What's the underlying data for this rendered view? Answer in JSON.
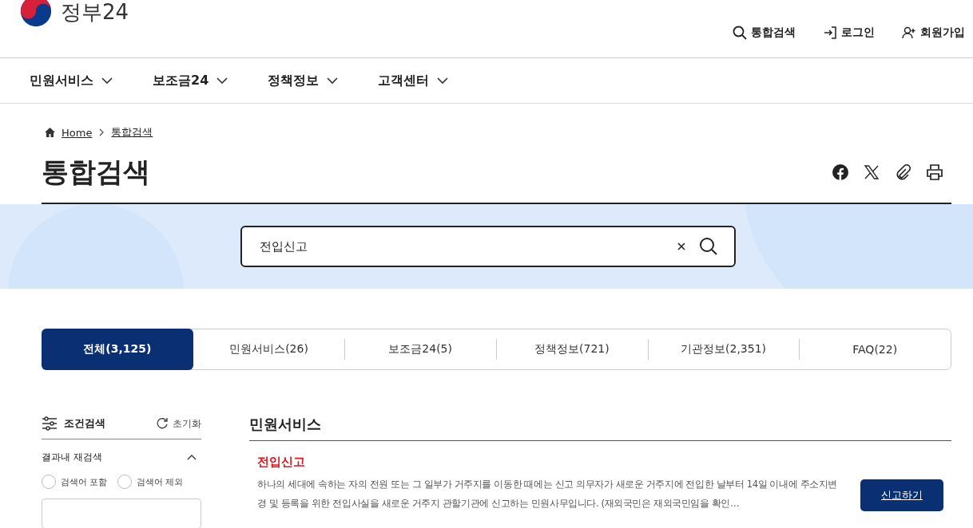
{
  "logo": {
    "text": "정부24"
  },
  "utility": [
    {
      "label": "통합검색",
      "kind": "search"
    },
    {
      "label": "로그인",
      "kind": "login"
    },
    {
      "label": "회원가입",
      "kind": "join"
    }
  ],
  "nav": [
    {
      "label": "민원서비스"
    },
    {
      "label": "보조금24"
    },
    {
      "label": "정책정보"
    },
    {
      "label": "고객센터"
    }
  ],
  "breadcrumb": [
    "Home",
    "통합검색"
  ],
  "page_title": "통합검색",
  "share_icons": [
    {
      "kind": "facebook"
    },
    {
      "kind": "x"
    },
    {
      "kind": "clip"
    },
    {
      "kind": "print"
    }
  ],
  "search": {
    "value": "전입신고"
  },
  "tabs": [
    {
      "label": "전체(3,125)",
      "selected": true
    },
    {
      "label": "민원서비스(26)",
      "selected": false
    },
    {
      "label": "보조금24(5)",
      "selected": false
    },
    {
      "label": "정책정보(721)",
      "selected": false
    },
    {
      "label": "기관정보(2,351)",
      "selected": false
    },
    {
      "label": "FAQ(22)",
      "selected": false
    }
  ],
  "sidebar": {
    "title": "조건검색",
    "reset": "초기화",
    "section": {
      "title": "결과내 재검색",
      "expanded": true
    },
    "options": [
      {
        "label": "검색어 포함",
        "selected": false
      },
      {
        "label": "검색어 제외",
        "selected": false
      }
    ]
  },
  "results": {
    "heading": "민원서비스",
    "items": [
      {
        "title": "전입신고",
        "description": "하나의 세대에 속하는 자의 전원 또는 그 일부가 거주지를 이동한 때에는 신고 의무자가 새로운 거주지에 전입한 날부터 14일 이내에 주소지변경 및 등록을 위한 전입사실을 새로운 거주지 관할기관에 신고하는 민원사무입니다. (재외국민은 재외국민임을 확인…",
        "action": "신고하기"
      }
    ]
  }
}
